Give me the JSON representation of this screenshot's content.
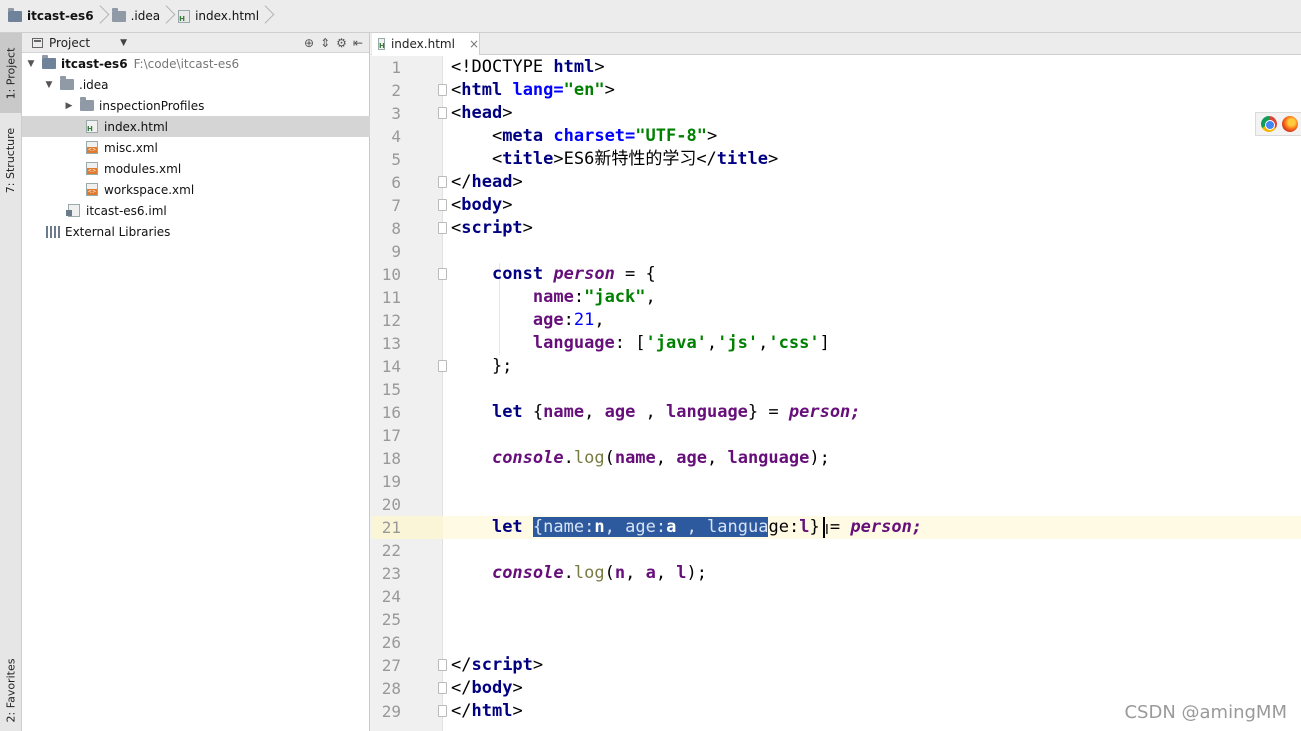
{
  "breadcrumb": {
    "project": "itcast-es6",
    "folder": ".idea",
    "file": "index.html"
  },
  "tool_strip": {
    "project_tab": "1: Project",
    "structure_tab": "7: Structure",
    "favorites_tab": "2: Favorites"
  },
  "project_panel": {
    "title": "Project",
    "tree": [
      {
        "label": "itcast-es6",
        "path": "F:\\code\\itcast-es6",
        "icon": "folder-icon",
        "arrow": "expanded"
      },
      {
        "label": ".idea",
        "icon": "folder-icon",
        "arrow": "expanded"
      },
      {
        "label": "inspectionProfiles",
        "icon": "folder-icon",
        "arrow": "collapsed"
      },
      {
        "label": "index.html",
        "icon": "html-file-icon",
        "selected": true
      },
      {
        "label": "misc.xml",
        "icon": "xml-file-icon"
      },
      {
        "label": "modules.xml",
        "icon": "xml-file-icon"
      },
      {
        "label": "workspace.xml",
        "icon": "xml-file-icon"
      },
      {
        "label": "itcast-es6.iml",
        "icon": "iml-file-icon"
      },
      {
        "label": "External Libraries",
        "icon": "library-icon"
      }
    ]
  },
  "editor": {
    "tab_label": "index.html",
    "current_line": 21,
    "lines": [
      {
        "n": "1"
      },
      {
        "n": "2"
      },
      {
        "n": "3"
      },
      {
        "n": "4"
      },
      {
        "n": "5"
      },
      {
        "n": "6"
      },
      {
        "n": "7"
      },
      {
        "n": "8"
      },
      {
        "n": "9"
      },
      {
        "n": "10"
      },
      {
        "n": "11"
      },
      {
        "n": "12"
      },
      {
        "n": "13"
      },
      {
        "n": "14"
      },
      {
        "n": "15"
      },
      {
        "n": "16"
      },
      {
        "n": "17"
      },
      {
        "n": "18"
      },
      {
        "n": "19"
      },
      {
        "n": "20"
      },
      {
        "n": "21"
      },
      {
        "n": "22"
      },
      {
        "n": "23"
      },
      {
        "n": "24"
      },
      {
        "n": "25"
      },
      {
        "n": "26"
      },
      {
        "n": "27"
      },
      {
        "n": "28"
      },
      {
        "n": "29"
      }
    ],
    "code": {
      "l1_a": "<!DOCTYPE ",
      "l1_b": "html",
      "l1_c": ">",
      "l2_a": "<",
      "l2_b": "html",
      "l2_c": " ",
      "l2_d": "lang=",
      "l2_e": "\"en\"",
      "l2_f": ">",
      "l3_a": "<",
      "l3_b": "head",
      "l3_c": ">",
      "l4_a": "    <",
      "l4_b": "meta",
      "l4_c": " ",
      "l4_d": "charset=",
      "l4_e": "\"UTF-8\"",
      "l4_f": ">",
      "l5_a": "    <",
      "l5_b": "title",
      "l5_c": ">ES6新特性的学习</",
      "l5_d": "title",
      "l5_e": ">",
      "l6_a": "</",
      "l6_b": "head",
      "l6_c": ">",
      "l7_a": "<",
      "l7_b": "body",
      "l7_c": ">",
      "l8_a": "<",
      "l8_b": "script",
      "l8_c": ">",
      "l10_a": "    ",
      "l10_b": "const",
      "l10_c": " ",
      "l10_d": "person",
      "l10_e": " = {",
      "l11_a": "        ",
      "l11_b": "name",
      "l11_c": ":",
      "l11_d": "\"jack\"",
      "l11_e": ",",
      "l12_a": "        ",
      "l12_b": "age",
      "l12_c": ":",
      "l12_d": "21",
      "l12_e": ",",
      "l13_a": "        ",
      "l13_b": "language",
      "l13_c": ": [",
      "l13_d": "'java'",
      "l13_e": ",",
      "l13_f": "'js'",
      "l13_g": ",",
      "l13_h": "'css'",
      "l13_i": "]",
      "l14_a": "    };",
      "l16_a": "    ",
      "l16_b": "let",
      "l16_c": " {",
      "l16_d": "name",
      "l16_e": ", ",
      "l16_f": "age",
      "l16_g": " , ",
      "l16_h": "language",
      "l16_i": "} = ",
      "l16_j": "person",
      "l16_k": ";",
      "l18_a": "    ",
      "l18_b": "console",
      "l18_c": ".",
      "l18_d": "log",
      "l18_e": "(",
      "l18_f": "name",
      "l18_g": ", ",
      "l18_h": "age",
      "l18_i": ", ",
      "l18_j": "language",
      "l18_k": ");",
      "l21_a": "    ",
      "l21_b": "let",
      "l21_c": " ",
      "l21_sel1": "{",
      "l21_sel2": "name",
      "l21_sel3": ":",
      "l21_sel4": "n",
      "l21_sel5": ", ",
      "l21_sel6": "age",
      "l21_sel7": ":",
      "l21_sel8": "a",
      "l21_sel9": " , ",
      "l21_sel10": "langua",
      "l21_d": "ge",
      "l21_e": ":",
      "l21_f": "l",
      "l21_g": "} = ",
      "l21_h": "person",
      "l21_i": ";",
      "l23_a": "    ",
      "l23_b": "console",
      "l23_c": ".",
      "l23_d": "log",
      "l23_e": "(",
      "l23_f": "n",
      "l23_g": ", ",
      "l23_h": "a",
      "l23_i": ", ",
      "l23_j": "l",
      "l23_k": ");",
      "l27_a": "</",
      "l27_b": "script",
      "l27_c": ">",
      "l28_a": "</",
      "l28_b": "body",
      "l28_c": ">",
      "l29_a": "</",
      "l29_b": "html",
      "l29_c": ">"
    }
  },
  "watermark": "CSDN @amingMM",
  "colors": {
    "tag": "#000080",
    "attribute": "#0000ff",
    "string": "#008000",
    "keyword": "#000080",
    "variable": "#660e7a",
    "number": "#0000ff",
    "selection": "#2d5a9e",
    "current_line": "#fffae3"
  }
}
